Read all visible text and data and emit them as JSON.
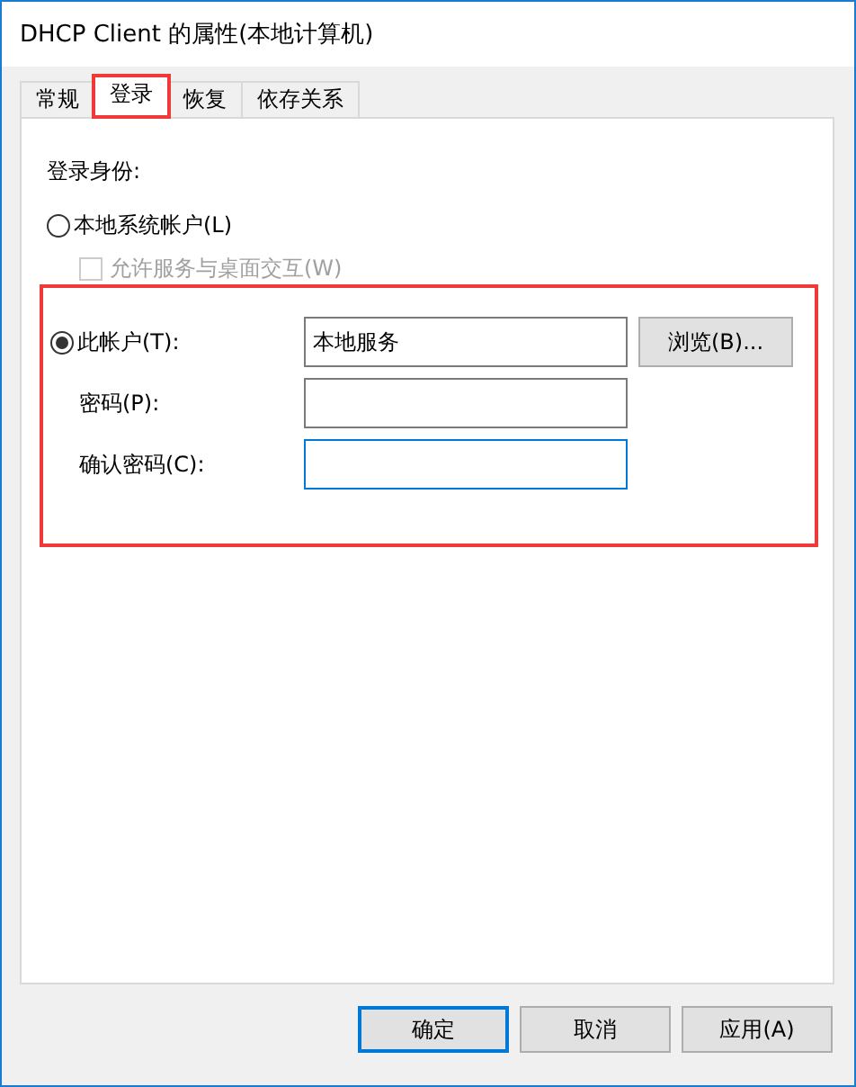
{
  "window": {
    "title": "DHCP Client 的属性(本地计算机)"
  },
  "tabs": [
    {
      "label": "常规",
      "selected": false,
      "highlighted": false
    },
    {
      "label": "登录",
      "selected": true,
      "highlighted": true
    },
    {
      "label": "恢复",
      "selected": false,
      "highlighted": false
    },
    {
      "label": "依存关系",
      "selected": false,
      "highlighted": false
    }
  ],
  "logon_as": {
    "heading": "登录身份:",
    "local_system": {
      "label": "本地系统帐户(L)",
      "selected": false
    },
    "desktop_interact": {
      "label": "允许服务与桌面交互(W)",
      "checked": false,
      "disabled": true
    },
    "this_account": {
      "label": "此帐户(T):",
      "selected": true,
      "value": "本地服务",
      "browse": "浏览(B)...",
      "highlighted": true
    },
    "password": {
      "label": "密码(P):"
    },
    "confirm": {
      "label": "确认密码(C):",
      "focused": true
    }
  },
  "buttons": [
    {
      "label": "确定",
      "default": true
    },
    {
      "label": "取消",
      "default": false
    },
    {
      "label": "应用(A)",
      "default": false
    }
  ]
}
